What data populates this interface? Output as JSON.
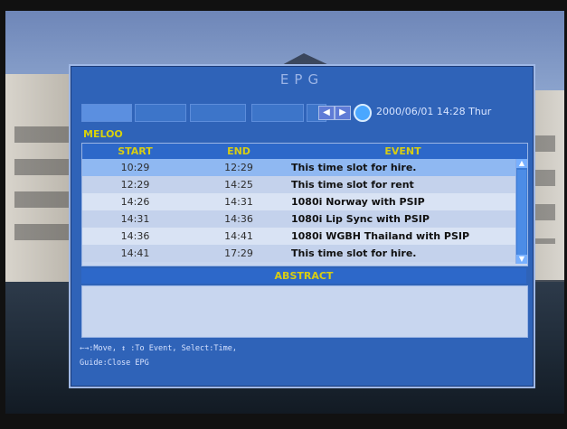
{
  "epg": {
    "title": "EPG",
    "date_time": "2000/06/01  14:28  Thur",
    "channel": "MELOO",
    "columns": [
      "START",
      "END",
      "EVENT"
    ],
    "rows": [
      {
        "start": "10:29",
        "end": "12:29",
        "event": "This time slot for hire."
      },
      {
        "start": "12:29",
        "end": "14:25",
        "event": "This time slot for rent"
      },
      {
        "start": "14:26",
        "end": "14:31",
        "event": "1080i Norway with PSIP"
      },
      {
        "start": "14:31",
        "end": "14:36",
        "event": "1080i Lip Sync with PSIP"
      },
      {
        "start": "14:36",
        "end": "14:41",
        "event": "1080i WGBH Thailand with PSIP"
      },
      {
        "start": "14:41",
        "end": "17:29",
        "event": "This time slot for hire."
      }
    ],
    "abstract_label": "ABSTRACT",
    "help": {
      "line1": "←→:Move,  ↕ :To Event,   Select:Time,",
      "line2": "Guide:Close EPG"
    }
  },
  "icons": {
    "left_arrow": "left-arrow-icon",
    "right_arrow": "right-arrow-icon",
    "clock": "clock-icon",
    "scroll_up": "scroll-up-icon",
    "scroll_down": "scroll-down-icon"
  }
}
